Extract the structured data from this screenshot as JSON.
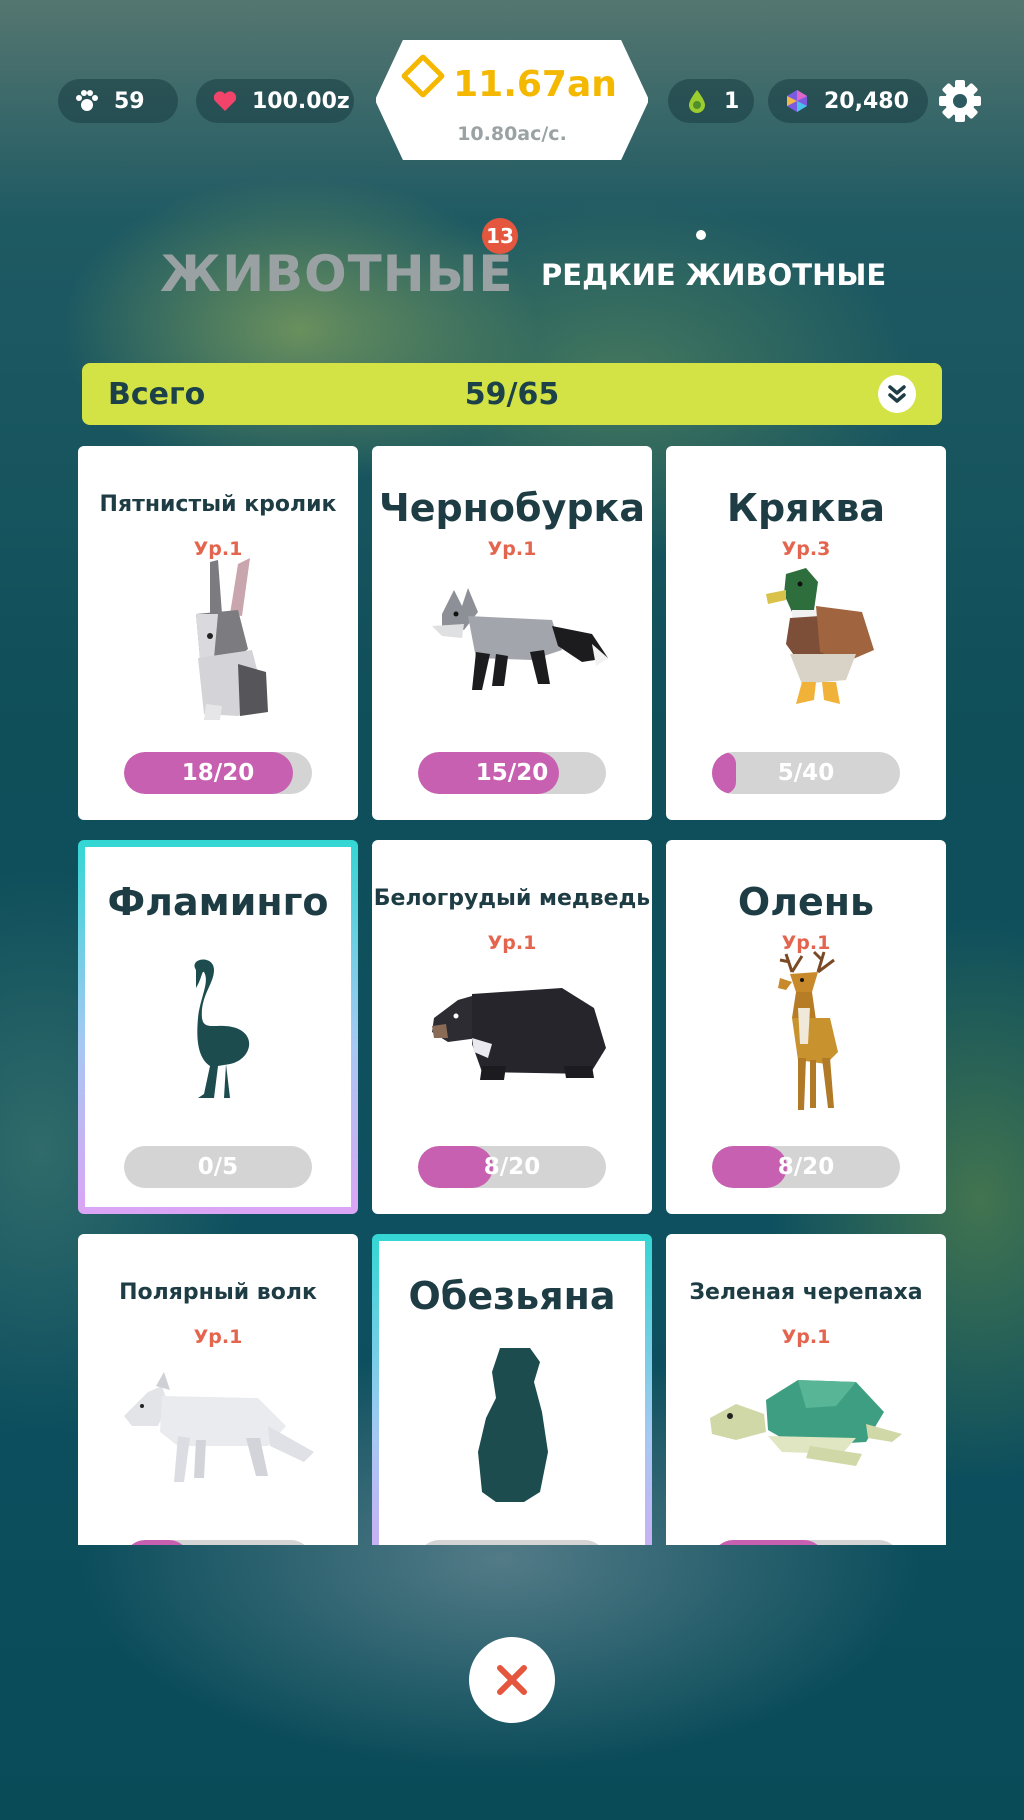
{
  "topbar": {
    "paws": "59",
    "hearts": "100.00z",
    "coins": "11.67an",
    "coin_rate": "10.80ас/с.",
    "drops": "1",
    "gems": "20,480"
  },
  "tabs": {
    "animals": "ЖИВОТНЫЕ",
    "badge": "13",
    "rare": "РЕДКИЕ ЖИВОТНЫЕ"
  },
  "total": {
    "label": "Всего",
    "count": "59/65"
  },
  "cards": [
    {
      "name": "Пятнистый кролик",
      "level": "Ур.1",
      "progress": "18/20",
      "fill": 0.9,
      "locked": false,
      "art": "rabbit"
    },
    {
      "name": "Чернобурка",
      "level": "Ур.1",
      "progress": "15/20",
      "fill": 0.75,
      "locked": false,
      "art": "fox"
    },
    {
      "name": "Кряква",
      "level": "Ур.3",
      "progress": "5/40",
      "fill": 0.125,
      "locked": false,
      "art": "duck"
    },
    {
      "name": "Фламинго",
      "level": "",
      "progress": "0/5",
      "fill": 0,
      "locked": true,
      "art": "flamingo"
    },
    {
      "name": "Белогрудый медведь",
      "level": "Ур.1",
      "progress": "8/20",
      "fill": 0.4,
      "locked": false,
      "art": "bear"
    },
    {
      "name": "Олень",
      "level": "Ур.1",
      "progress": "8/20",
      "fill": 0.4,
      "locked": false,
      "art": "deer"
    },
    {
      "name": "Полярный волк",
      "level": "Ур.1",
      "progress": "",
      "fill": 0.35,
      "locked": false,
      "art": "wolf"
    },
    {
      "name": "Обезьяна",
      "level": "",
      "progress": "",
      "fill": 0,
      "locked": true,
      "art": "monkey"
    },
    {
      "name": "Зеленая черепаха",
      "level": "Ур.1",
      "progress": "",
      "fill": 0.6,
      "locked": false,
      "art": "turtle"
    }
  ],
  "colors": {
    "accent_bar": "#d3e244",
    "progress_fill": "#c860b2",
    "level_text": "#e4654d",
    "coin": "#f5b800",
    "badge": "#e4573e"
  },
  "icons": {
    "paws": "paw-icon",
    "hearts": "heart-icon",
    "coins": "coin-diamond-icon",
    "drops": "drop-icon",
    "gems": "gem-icon",
    "settings": "gear-icon",
    "expand": "double-chevron-down-icon",
    "close": "close-icon"
  }
}
